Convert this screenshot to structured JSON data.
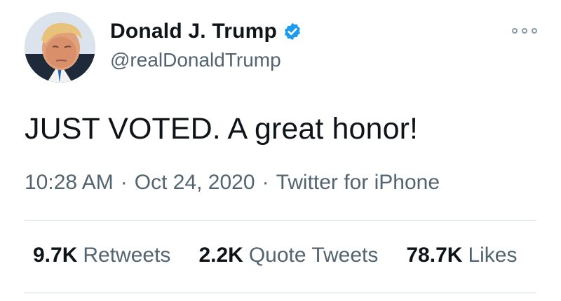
{
  "user": {
    "display_name": "Donald J. Trump",
    "handle": "@realDonaldTrump",
    "verified": true,
    "verified_color": "#1d9bf0",
    "avatar_icon": "profile-photo"
  },
  "tweet": {
    "text": "JUST VOTED. A great honor!",
    "time": "10:28 AM",
    "date": "Oct 24, 2020",
    "source": "Twitter for iPhone",
    "separator": "·"
  },
  "stats": {
    "retweets": {
      "count": "9.7K",
      "label": "Retweets"
    },
    "quotes": {
      "count": "2.2K",
      "label": "Quote Tweets"
    },
    "likes": {
      "count": "78.7K",
      "label": "Likes"
    }
  },
  "menu": {
    "icon": "more-options-icon"
  },
  "colors": {
    "text_primary": "#0f1419",
    "text_secondary": "#536471",
    "divider": "#cfd9de"
  }
}
